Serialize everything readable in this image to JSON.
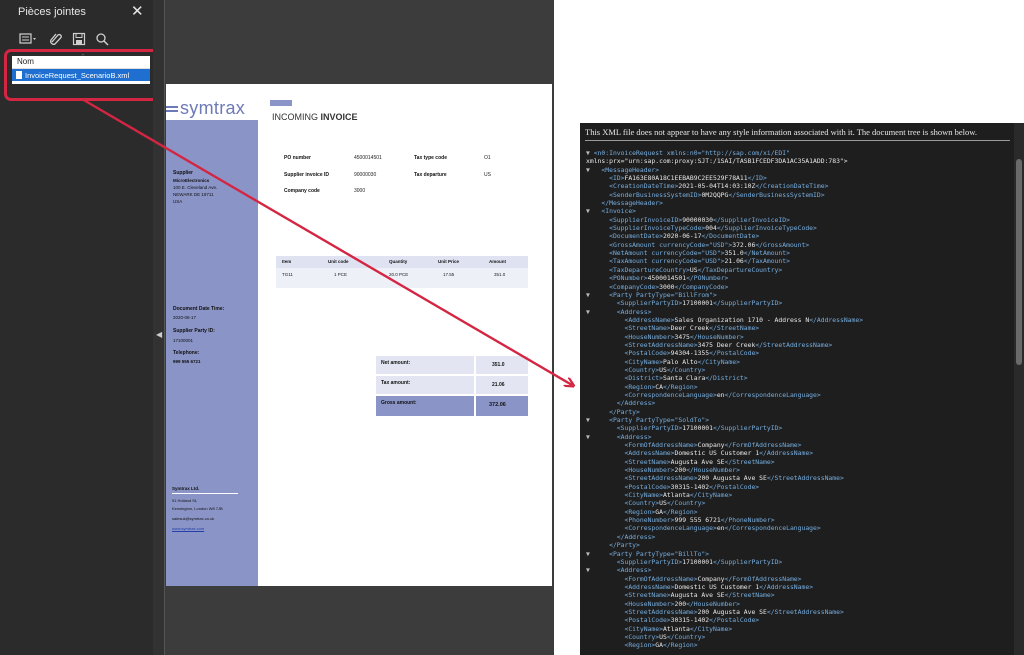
{
  "attachments_panel": {
    "title": "Pièces jointes",
    "close_icon": "close-icon",
    "toolbar_icons": [
      "options-icon",
      "attach-icon",
      "save-icon",
      "search-icon"
    ],
    "column_header": "Nom",
    "files": [
      "InvoiceRequest_ScenarioB.xml"
    ]
  },
  "invoice": {
    "logo": "symtrax",
    "title_light": "INCOMING ",
    "title_bold": "INVOICE",
    "fields": {
      "po_label": "PO number",
      "po_value": "4500014501",
      "tax_type_label": "Tax type code",
      "tax_type_value": "O1",
      "supplier_inv_label": "Supplier invoice ID",
      "supplier_inv_value": "90000030",
      "tax_dep_label": "Tax departure",
      "tax_dep_value": "US",
      "company_label": "Company code",
      "company_value": "3000"
    },
    "supplier": {
      "label": "Supplier",
      "name": "MicroElectronics",
      "street": "100 E. Cleveland Ave.",
      "city": "NEWARK DE 19711",
      "country": "USA"
    },
    "side": {
      "doc_date_label": "Document Date Time:",
      "doc_date_value": "2020-06-17",
      "party_label": "Supplier Party ID:",
      "party_value": "17100001",
      "phone_label": "Telephone:",
      "phone_value": "999 555 6721",
      "footer_company": "Symtrax Ltd.",
      "footer_addr1": "91 Holland St,",
      "footer_addr2": "Kensington, London W8 7JB",
      "footer_email": "salesuk@symtrax.co.uk",
      "footer_web": "www.symtrax.com"
    },
    "items_table": {
      "headers": [
        "Item",
        "Unit code",
        "Quantity",
        "Unit Price",
        "Amount"
      ],
      "rows": [
        [
          "TG11",
          "1  PCE",
          "20.0 PCE",
          "17.55",
          "351.0"
        ]
      ]
    },
    "totals": {
      "net_label": "Net amount:",
      "net_value": "351.0",
      "tax_label": "Tax amount:",
      "tax_value": "21.06",
      "gross_label": "Gross amount:",
      "gross_value": "372.06"
    }
  },
  "xml_viewer": {
    "notice": "This XML file does not appear to have any style information associated with it. The document tree is shown below.",
    "lines": [
      {
        "t": "▼",
        "i": 0,
        "s": "<n0:InvoiceRequest xmlns:n0=\"http://sap.com/xi/EDI\""
      },
      {
        "t": "",
        "i": 0,
        "s": "xmlns:prx=\"urn:sap.com:proxy:SJT:/1SAI/TASB1FCEDF3DA1AC35A1ADD:783\">"
      },
      {
        "t": "▼",
        "i": 1,
        "s": "<MessageHeader>"
      },
      {
        "t": "",
        "i": 2,
        "s": "<ID>FA163E80A18C1EEBAB9C2EE529F78A11</ID>"
      },
      {
        "t": "",
        "i": 2,
        "s": "<CreationDateTime>2021-05-04T14:03:10Z</CreationDateTime>"
      },
      {
        "t": "",
        "i": 2,
        "s": "<SenderBusinessSystemID>0M2QQPG</SenderBusinessSystemID>"
      },
      {
        "t": "",
        "i": 1,
        "s": "</MessageHeader>"
      },
      {
        "t": "▼",
        "i": 1,
        "s": "<Invoice>"
      },
      {
        "t": "",
        "i": 2,
        "s": "<SupplierInvoiceID>90000030</SupplierInvoiceID>"
      },
      {
        "t": "",
        "i": 2,
        "s": "<SupplierInvoiceTypeCode>004</SupplierInvoiceTypeCode>"
      },
      {
        "t": "",
        "i": 2,
        "s": "<DocumentDate>2020-06-17</DocumentDate>"
      },
      {
        "t": "",
        "i": 2,
        "s": "<GrossAmount currencyCode=\"USD\">372.06</GrossAmount>"
      },
      {
        "t": "",
        "i": 2,
        "s": "<NetAmount currencyCode=\"USD\">351.0</NetAmount>"
      },
      {
        "t": "",
        "i": 2,
        "s": "<TaxAmount currencyCode=\"USD\">21.06</TaxAmount>"
      },
      {
        "t": "",
        "i": 2,
        "s": "<TaxDepartureCountry>US</TaxDepartureCountry>"
      },
      {
        "t": "",
        "i": 2,
        "s": "<PONumber>4500014501</PONumber>"
      },
      {
        "t": "",
        "i": 2,
        "s": "<CompanyCode>3000</CompanyCode>"
      },
      {
        "t": "▼",
        "i": 2,
        "s": "<Party PartyType=\"BillFrom\">"
      },
      {
        "t": "",
        "i": 3,
        "s": "<SupplierPartyID>17100001</SupplierPartyID>"
      },
      {
        "t": "▼",
        "i": 3,
        "s": "<Address>"
      },
      {
        "t": "",
        "i": 4,
        "s": "<AddressName>Sales Organization 1710 - Address N</AddressName>"
      },
      {
        "t": "",
        "i": 4,
        "s": "<StreetName>Deer Creek</StreetName>"
      },
      {
        "t": "",
        "i": 4,
        "s": "<HouseNumber>3475</HouseNumber>"
      },
      {
        "t": "",
        "i": 4,
        "s": "<StreetAddressName>3475 Deer Creek</StreetAddressName>"
      },
      {
        "t": "",
        "i": 4,
        "s": "<PostalCode>94304-1355</PostalCode>"
      },
      {
        "t": "",
        "i": 4,
        "s": "<CityName>Palo Alto</CityName>"
      },
      {
        "t": "",
        "i": 4,
        "s": "<Country>US</Country>"
      },
      {
        "t": "",
        "i": 4,
        "s": "<District>Santa Clara</District>"
      },
      {
        "t": "",
        "i": 4,
        "s": "<Region>CA</Region>"
      },
      {
        "t": "",
        "i": 4,
        "s": "<CorrespondenceLanguage>en</CorrespondenceLanguage>"
      },
      {
        "t": "",
        "i": 3,
        "s": "</Address>"
      },
      {
        "t": "",
        "i": 2,
        "s": "</Party>"
      },
      {
        "t": "▼",
        "i": 2,
        "s": "<Party PartyType=\"SoldTo\">"
      },
      {
        "t": "",
        "i": 3,
        "s": "<SupplierPartyID>17100001</SupplierPartyID>"
      },
      {
        "t": "▼",
        "i": 3,
        "s": "<Address>"
      },
      {
        "t": "",
        "i": 4,
        "s": "<FormOfAddressName>Company</FormOfAddressName>"
      },
      {
        "t": "",
        "i": 4,
        "s": "<AddressName>Domestic US Customer 1</AddressName>"
      },
      {
        "t": "",
        "i": 4,
        "s": "<StreetName>Augusta Ave SE</StreetName>"
      },
      {
        "t": "",
        "i": 4,
        "s": "<HouseNumber>200</HouseNumber>"
      },
      {
        "t": "",
        "i": 4,
        "s": "<StreetAddressName>200 Augusta Ave SE</StreetAddressName>"
      },
      {
        "t": "",
        "i": 4,
        "s": "<PostalCode>30315-1402</PostalCode>"
      },
      {
        "t": "",
        "i": 4,
        "s": "<CityName>Atlanta</CityName>"
      },
      {
        "t": "",
        "i": 4,
        "s": "<Country>US</Country>"
      },
      {
        "t": "",
        "i": 4,
        "s": "<Region>GA</Region>"
      },
      {
        "t": "",
        "i": 4,
        "s": "<PhoneNumber>999 555 6721</PhoneNumber>"
      },
      {
        "t": "",
        "i": 4,
        "s": "<CorrespondenceLanguage>en</CorrespondenceLanguage>"
      },
      {
        "t": "",
        "i": 3,
        "s": "</Address>"
      },
      {
        "t": "",
        "i": 2,
        "s": "</Party>"
      },
      {
        "t": "▼",
        "i": 2,
        "s": "<Party PartyType=\"BillTo\">"
      },
      {
        "t": "",
        "i": 3,
        "s": "<SupplierPartyID>17100001</SupplierPartyID>"
      },
      {
        "t": "▼",
        "i": 3,
        "s": "<Address>"
      },
      {
        "t": "",
        "i": 4,
        "s": "<FormOfAddressName>Company</FormOfAddressName>"
      },
      {
        "t": "",
        "i": 4,
        "s": "<AddressName>Domestic US Customer 1</AddressName>"
      },
      {
        "t": "",
        "i": 4,
        "s": "<StreetName>Augusta Ave SE</StreetName>"
      },
      {
        "t": "",
        "i": 4,
        "s": "<HouseNumber>200</HouseNumber>"
      },
      {
        "t": "",
        "i": 4,
        "s": "<StreetAddressName>200 Augusta Ave SE</StreetAddressName>"
      },
      {
        "t": "",
        "i": 4,
        "s": "<PostalCode>30315-1402</PostalCode>"
      },
      {
        "t": "",
        "i": 4,
        "s": "<CityName>Atlanta</CityName>"
      },
      {
        "t": "",
        "i": 4,
        "s": "<Country>US</Country>"
      },
      {
        "t": "",
        "i": 4,
        "s": "<Region>GA</Region>"
      }
    ]
  },
  "colors": {
    "panel_bg": "#2b2b2b",
    "highlight": "#d42643",
    "invoice_accent": "#8a94c6",
    "xml_bg": "#1e1e1e",
    "xml_tag": "#76aee0"
  }
}
